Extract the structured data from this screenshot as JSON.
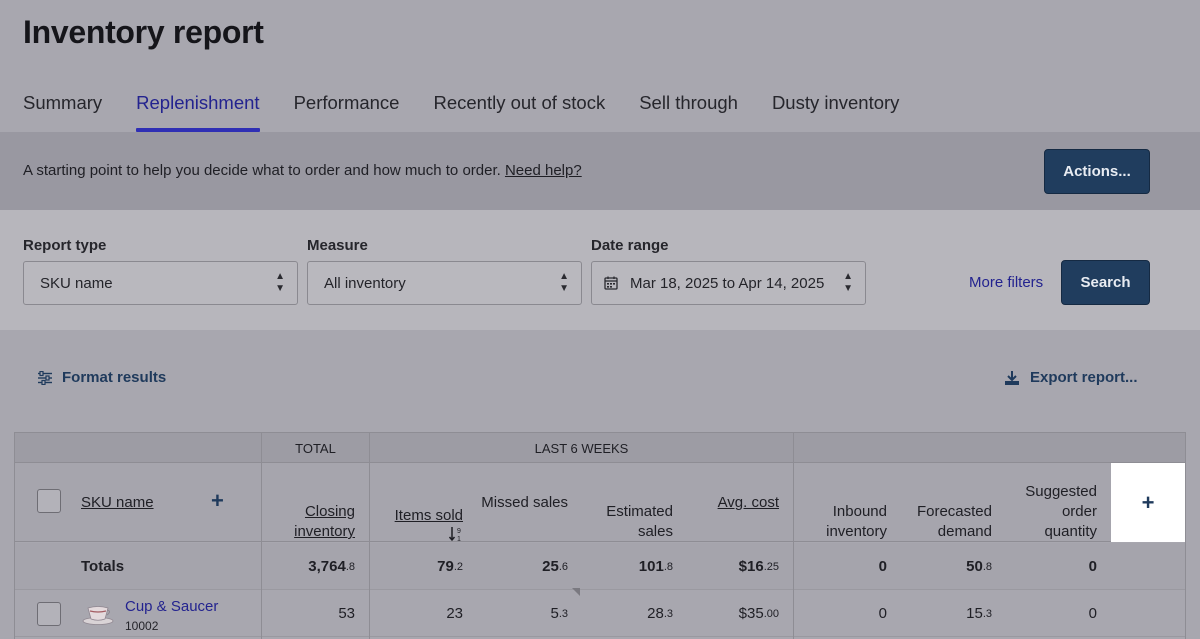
{
  "page": {
    "title": "Inventory report"
  },
  "tabs": [
    {
      "label": "Summary",
      "active": false
    },
    {
      "label": "Replenishment",
      "active": true
    },
    {
      "label": "Performance",
      "active": false
    },
    {
      "label": "Recently out of stock",
      "active": false
    },
    {
      "label": "Sell through",
      "active": false
    },
    {
      "label": "Dusty inventory",
      "active": false
    }
  ],
  "info": {
    "text": "A starting point to help you decide what to order and how much to order.",
    "help_link": "Need help?",
    "actions_label": "Actions..."
  },
  "filters": {
    "report_type": {
      "label": "Report type",
      "value": "SKU name"
    },
    "measure": {
      "label": "Measure",
      "value": "All inventory"
    },
    "date_range": {
      "label": "Date range",
      "value": "Mar 18, 2025 to Apr 14, 2025"
    },
    "more_filters": "More filters",
    "search_label": "Search"
  },
  "toolbar": {
    "format_label": "Format results",
    "export_label": "Export report..."
  },
  "table": {
    "groups": {
      "total": "TOTAL",
      "last6": "LAST 6 WEEKS"
    },
    "headers": {
      "sku": "SKU name",
      "closing1": "Closing",
      "closing2": "inventory",
      "items_sold": "Items sold",
      "missed": "Missed sales",
      "est1": "Estimated",
      "est2": "sales",
      "avg": "Avg. cost",
      "inb1": "Inbound",
      "inb2": "inventory",
      "fc1": "Forecasted",
      "fc2": "demand",
      "sug1": "Suggested",
      "sug2": "order",
      "sug3": "quantity"
    },
    "totals": {
      "label": "Totals",
      "closing": "3,764",
      "closing_f": ".8",
      "items_sold": "79",
      "items_sold_f": ".2",
      "missed": "25",
      "missed_f": ".6",
      "est": "101",
      "est_f": ".8",
      "avg": "$16",
      "avg_f": ".25",
      "inbound": "0",
      "forecast": "50",
      "forecast_f": ".8",
      "suggested": "0"
    },
    "rows": [
      {
        "name": "Cup & Saucer",
        "sku_id": "10002",
        "closing": "53",
        "items_sold": "23",
        "missed": "5",
        "missed_f": ".3",
        "est": "28",
        "est_f": ".3",
        "avg": "$35",
        "avg_f": ".00",
        "inbound": "0",
        "forecast": "15",
        "forecast_f": ".3",
        "suggested": "0"
      }
    ]
  },
  "colors": {
    "accent": "#2f2fb4",
    "button": "#203d5e",
    "link": "#23238f"
  }
}
